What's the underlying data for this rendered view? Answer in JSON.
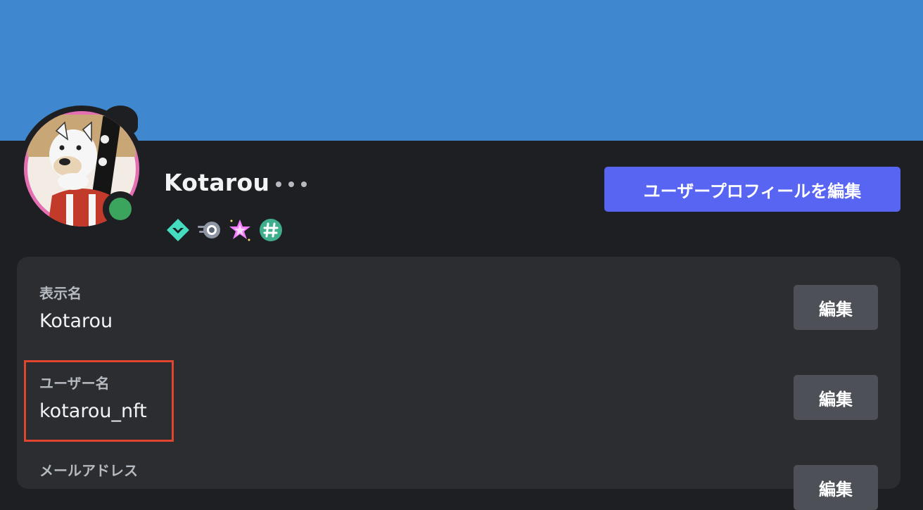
{
  "colors": {
    "banner": "#3f88cf",
    "background": "#1e1f22",
    "card": "#2b2d31",
    "primary_button": "#5865f2",
    "secondary_button": "#4e5058",
    "status_online": "#3ba55d",
    "avatar_ring": "#e46fb3",
    "highlight": "#e0462f"
  },
  "profile": {
    "display_name": "Kotarou",
    "status": "online",
    "badges": [
      {
        "icon": "hypesquad-balance-badge-icon"
      },
      {
        "icon": "nitro-boost-badge-icon"
      },
      {
        "icon": "quest-star-badge-icon"
      },
      {
        "icon": "hash-badge-icon"
      }
    ]
  },
  "edit_profile_button": "ユーザープロフィールを編集",
  "fields": [
    {
      "label": "表示名",
      "value": "Kotarou",
      "edit_label": "編集"
    },
    {
      "label": "ユーザー名",
      "value": "kotarou_nft",
      "edit_label": "編集"
    },
    {
      "label": "メールアドレス",
      "value": "",
      "edit_label": "編集"
    }
  ]
}
